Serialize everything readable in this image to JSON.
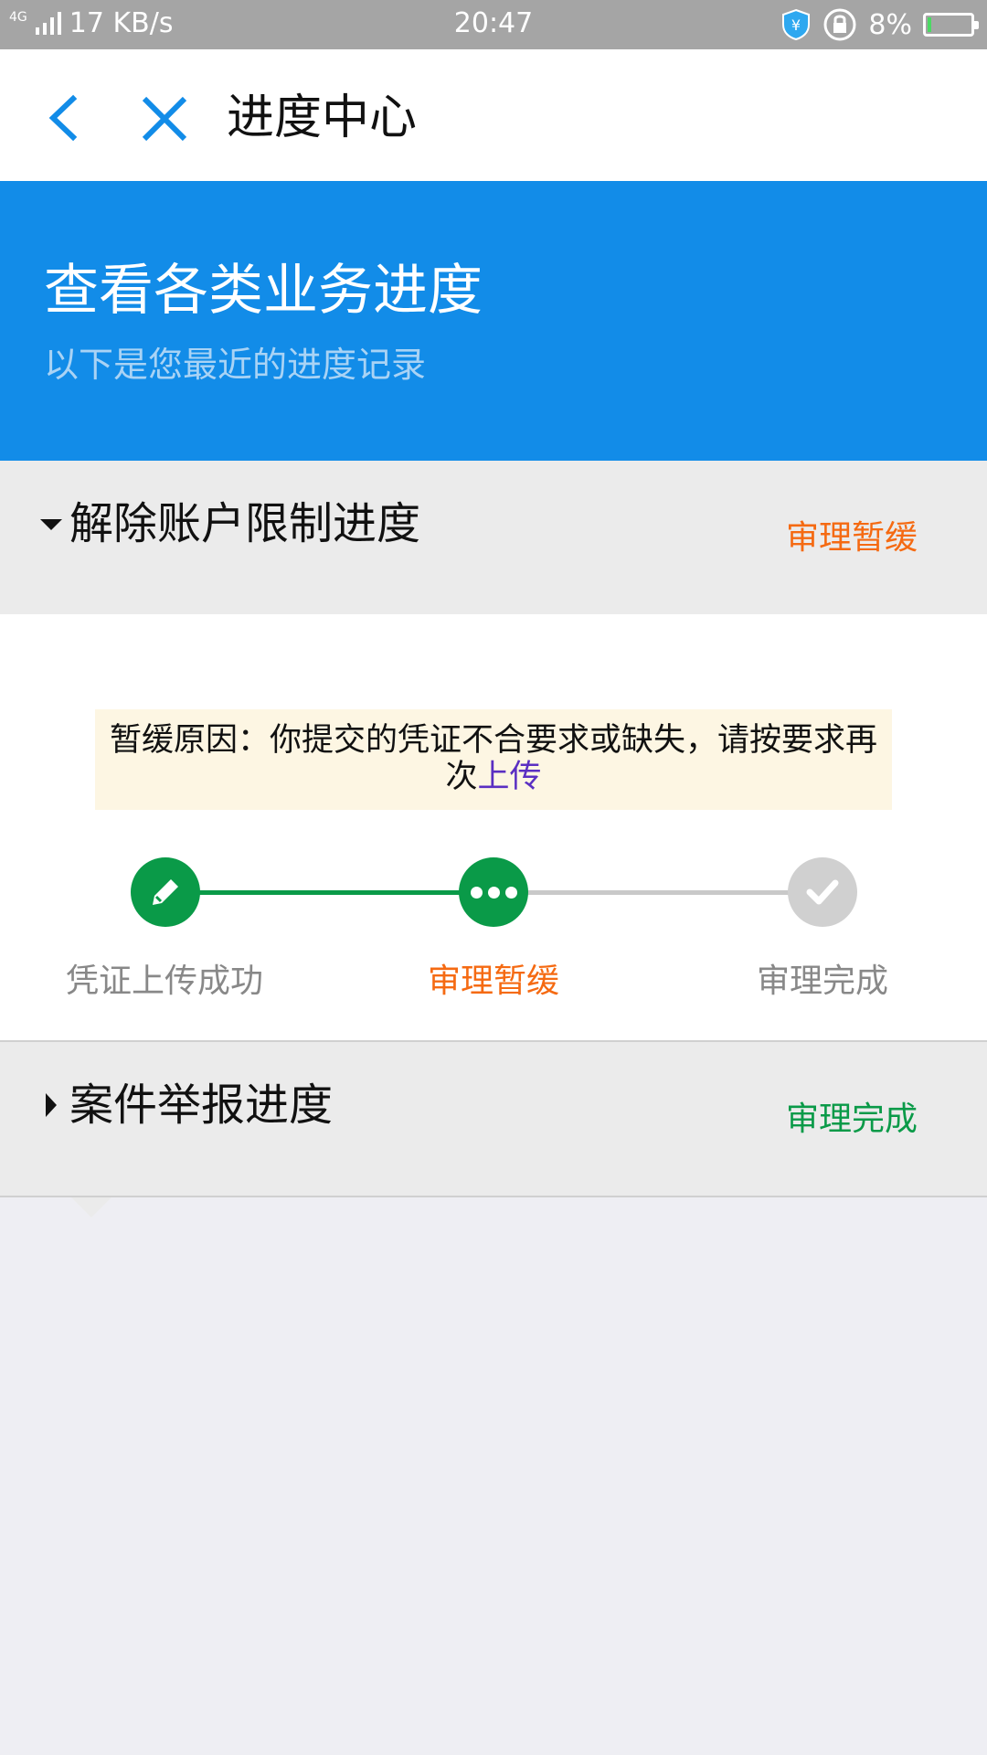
{
  "status_bar": {
    "network": "4G",
    "speed": "17 KB/s",
    "time": "20:47",
    "battery_text": "8%",
    "battery_level": 0.08
  },
  "nav": {
    "title": "进度中心"
  },
  "banner": {
    "title": "查看各类业务进度",
    "subtitle": "以下是您最近的进度记录"
  },
  "sections": [
    {
      "title": "解除账户限制进度",
      "status": "审理暂缓",
      "status_color": "#f56a12",
      "expanded": true,
      "notice_text": "暂缓原因：你提交的凭证不合要求或缺失，请按要求再次",
      "notice_link": "上传",
      "steps": [
        {
          "label": "凭证上传成功",
          "state": "done",
          "icon": "pencil-icon",
          "label_color": "#888888"
        },
        {
          "label": "审理暂缓",
          "state": "current",
          "icon": "more-dots-icon",
          "label_color": "#f56a12"
        },
        {
          "label": "审理完成",
          "state": "pending",
          "icon": "check-icon",
          "label_color": "#888888"
        }
      ]
    },
    {
      "title": "案件举报进度",
      "status": "审理完成",
      "status_color": "#0a9a48",
      "expanded": false
    }
  ],
  "colors": {
    "accent_blue": "#128ce8",
    "done_green": "#0a9a48",
    "pending_gray": "#c9c9c9"
  }
}
